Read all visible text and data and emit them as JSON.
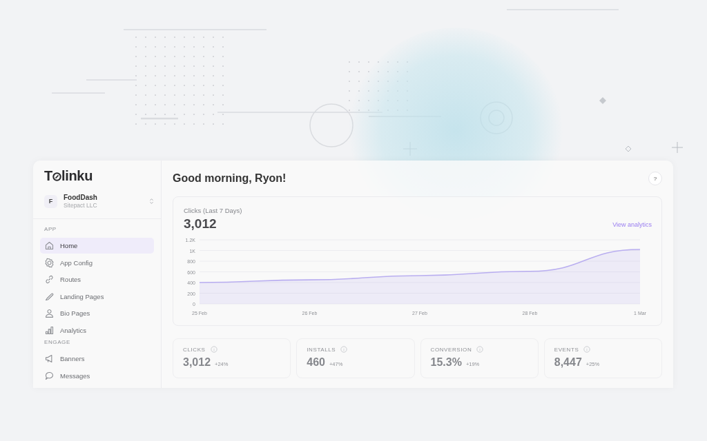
{
  "logo": {
    "lead": "T",
    "rest": "linku"
  },
  "org": {
    "initial": "F",
    "name": "FoodDash",
    "company": "Sitepact LLC"
  },
  "sidebar": {
    "sections": [
      {
        "label": "APP",
        "items": [
          {
            "label": "Home",
            "selected": true
          },
          {
            "label": "App Config",
            "selected": false
          },
          {
            "label": "Routes",
            "selected": false
          },
          {
            "label": "Landing Pages",
            "selected": false
          },
          {
            "label": "Bio Pages",
            "selected": false
          },
          {
            "label": "Analytics",
            "selected": false
          }
        ]
      },
      {
        "label": "ENGAGE",
        "items": [
          {
            "label": "Banners",
            "selected": false
          },
          {
            "label": "Messages",
            "selected": false
          }
        ]
      }
    ]
  },
  "header": {
    "greeting": "Good morning, Ryon!",
    "help": "?"
  },
  "clicks_card": {
    "title": "Clicks (Last 7 Days)",
    "total": "3,012",
    "link": "View analytics",
    "chart_data": {
      "type": "area",
      "categories": [
        "25 Feb",
        "26 Feb",
        "27 Feb",
        "28 Feb",
        "1 Mar"
      ],
      "series": [
        {
          "color": "#b9aef0",
          "values": [
            400,
            450,
            530,
            610,
            1020
          ]
        }
      ],
      "grid": true,
      "ylim": [
        0,
        1200
      ],
      "yticks": [
        0,
        200,
        400,
        600,
        800,
        {
          "value": 1000,
          "label": "1K"
        },
        {
          "value": 1200,
          "label": "1.2K"
        }
      ]
    }
  },
  "stats": [
    {
      "label": "CLICKS",
      "value": "3,012",
      "change": "+24%"
    },
    {
      "label": "INSTALLS",
      "value": "460",
      "change": "+47%"
    },
    {
      "label": "CONVERSION",
      "value": "15.3%",
      "change": "+19%"
    },
    {
      "label": "EVENTS",
      "value": "8,447",
      "change": "+25%"
    }
  ]
}
